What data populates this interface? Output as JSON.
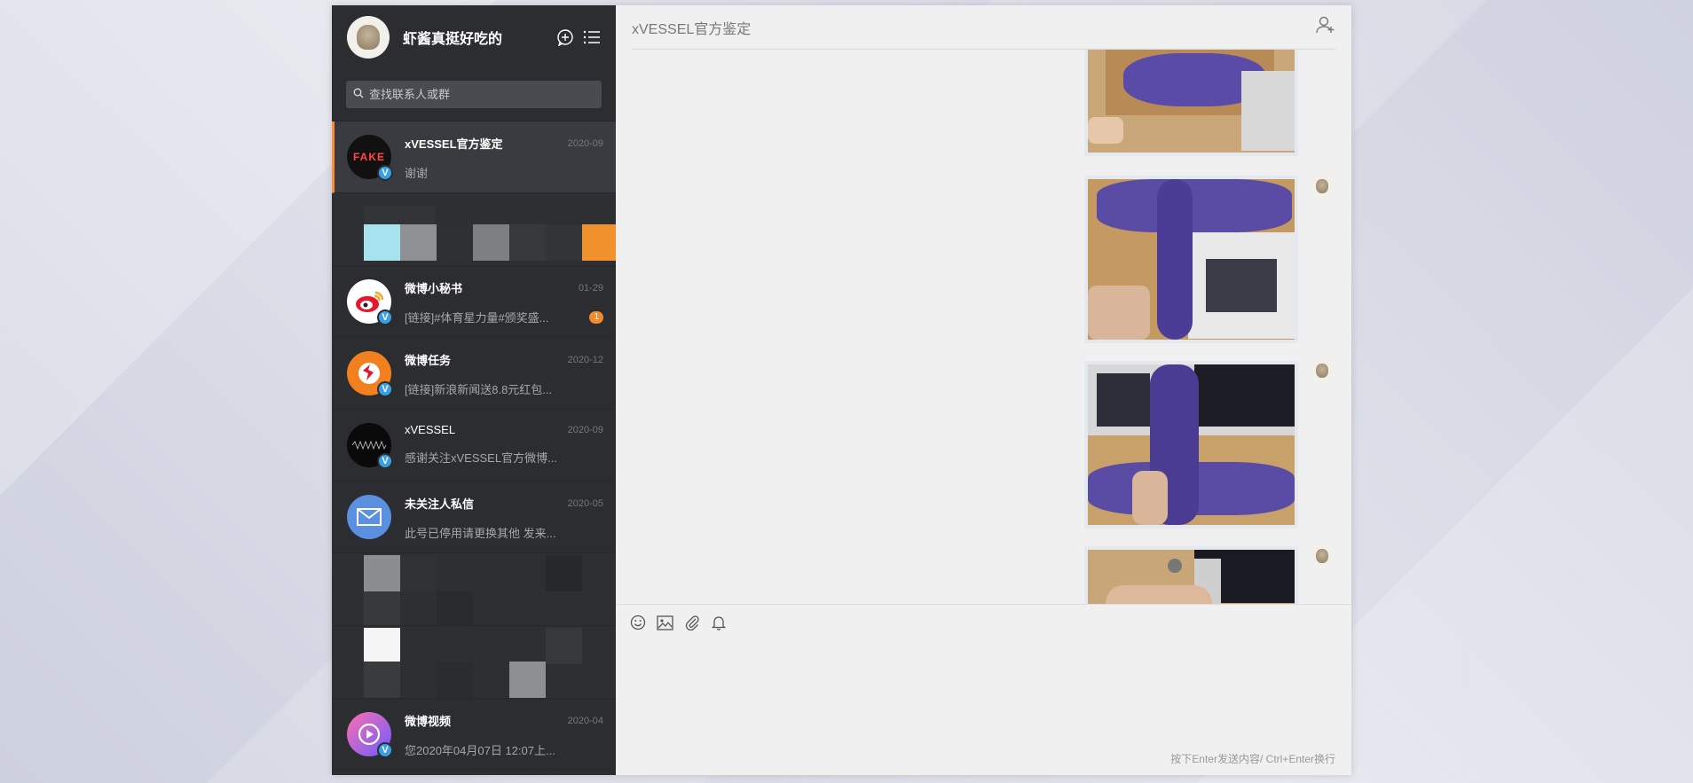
{
  "profile": {
    "name": "虾酱真挺好吃的"
  },
  "search": {
    "placeholder": "查找联系人或群"
  },
  "conversations": [
    {
      "name": "xVESSEL官方鉴定",
      "time": "2020-09",
      "message": "谢谢",
      "avatar_text": "FAKE",
      "active": true
    },
    {
      "name": "微博小秘书",
      "time": "01-29",
      "message": "[链接]#体育星力量#颁奖盛...",
      "unread": "1"
    },
    {
      "name": "微博任务",
      "time": "2020-12",
      "message": "[链接]新浪新闻送8.8元红包..."
    },
    {
      "name": "xVESSEL",
      "time": "2020-09",
      "message": "感谢关注xVESSEL官方微博..."
    },
    {
      "name": "未关注人私信",
      "time": "2020-05",
      "message": "此号已停用请更换其他 发来..."
    },
    {
      "name": "微博视频",
      "time": "2020-04",
      "message": "您2020年04月07日 12:07上..."
    }
  ],
  "chat": {
    "title": "xVESSEL官方鉴定",
    "hint": "按下Enter发送内容/ Ctrl+Enter换行"
  },
  "icons": {
    "new_chat": "chat-plus-icon",
    "menu": "list-menu-icon",
    "search": "search-icon",
    "add_member": "add-user-icon",
    "emoji": "smiley-icon",
    "image": "image-icon",
    "attach": "paperclip-icon",
    "bell": "bell-icon"
  },
  "colors": {
    "accent": "#ff8c3a",
    "sidebar": "#2c2d31",
    "verified": "#3aa0e5"
  }
}
